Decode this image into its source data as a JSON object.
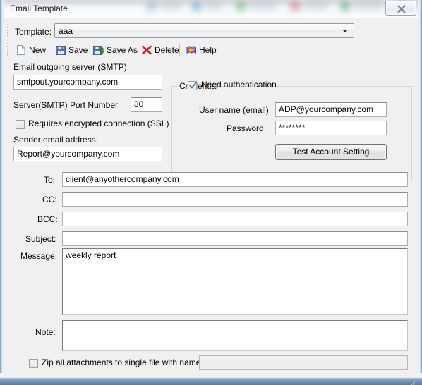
{
  "window": {
    "title": "Email Template",
    "close_label": "Close",
    "close_icon": "close-x-icon"
  },
  "template_bar": {
    "label": "Template:",
    "selected": "aaa",
    "options": [
      "aaa"
    ],
    "arrow_icon": "chevron-down-icon"
  },
  "toolbar": {
    "buttons": [
      {
        "label": "New",
        "icon": "new-document-icon"
      },
      {
        "label": "Save",
        "icon": "floppy-disk-icon"
      },
      {
        "label": "Save As",
        "icon": "floppy-disk-arrow-icon"
      },
      {
        "label": "Delete",
        "icon": "red-x-icon"
      },
      {
        "label": "Help",
        "icon": "help-book-icon"
      }
    ]
  },
  "smtp": {
    "server_label": "Email outgoing server (SMTP)",
    "server_value": "smtpout.yourcompany.com",
    "port_label": "Server(SMTP) Port Number",
    "port_value": "80",
    "ssl_label": "Requires encrypted connection (SSL)",
    "ssl_checked": false,
    "sender_label": "Sender email address:",
    "sender_value": "Report@yourcompany.com"
  },
  "credential": {
    "legend": "Credential",
    "need_auth_label": "Need authentication",
    "need_auth_checked": true,
    "username_label": "User name (email)",
    "username_value": "ADP@yourcompany.com",
    "password_label": "Password",
    "password_value": "********",
    "test_button_label": "Test Account Setting"
  },
  "message_form": {
    "to_label": "To:",
    "to_value": "client@anyothercompany.com",
    "cc_label": "CC:",
    "cc_value": "",
    "bcc_label": "BCC:",
    "bcc_value": "",
    "subject_label": "Subject:",
    "subject_value": "",
    "message_label": "Message:",
    "message_value": "weekly report",
    "note_label": "Note:",
    "note_value": ""
  },
  "zip_row": {
    "checkbox_label": "Zip all attachments to single file with name:",
    "checked": false,
    "filename_value": ""
  },
  "colors": {
    "window_bg": "#f0f0f0",
    "field_bg": "#ffffff",
    "field_border": "#abadb3",
    "frame_blue": "#7f9bbd",
    "checkmark_blue": "#2e6ca5",
    "delete_red": "#cc1f1f"
  }
}
